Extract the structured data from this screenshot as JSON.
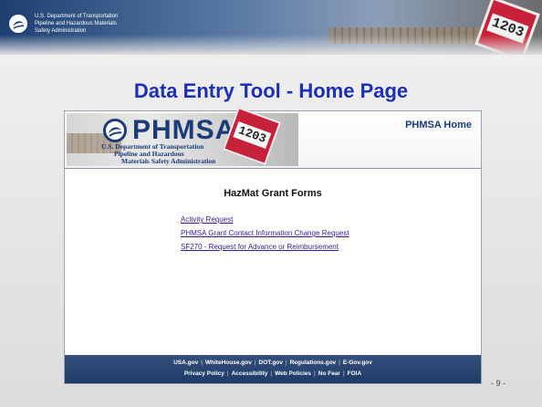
{
  "banner": {
    "agency_line1": "U.S. Department of Transportation",
    "agency_line2": "Pipeline and Hazardous Materials",
    "agency_line3": "Safety Administration",
    "placard_number": "1203"
  },
  "slide": {
    "title": "Data Entry Tool - Home Page",
    "page_number": "- 9 -"
  },
  "site": {
    "logo_brand": "PHMSA",
    "logo_sub1": "U.S. Department of Transportation",
    "logo_sub2": "Pipeline and Hazardous",
    "logo_sub3": "Materials Safety Administration",
    "placard_number": "1203",
    "home_link": "PHMSA Home"
  },
  "main": {
    "heading": "HazMat Grant Forms",
    "links": [
      "Activity Request",
      "PHMSA Grant Contact Information Change Request",
      "SF270 - Request for Advance or Reimbursement"
    ]
  },
  "footer": {
    "row1": [
      "USA.gov",
      "WhiteHouse.gov",
      "DOT.gov",
      "Regulations.gov",
      "E-Gov.gov"
    ],
    "row2": [
      "Privacy Policy",
      "Accessibility",
      "Web Policies",
      "No Fear",
      "FOIA"
    ]
  },
  "colors": {
    "title": "#1d2fb4",
    "link": "#3b1a8f",
    "footer_bg": "#1e3a66",
    "placard": "#c8223a"
  }
}
